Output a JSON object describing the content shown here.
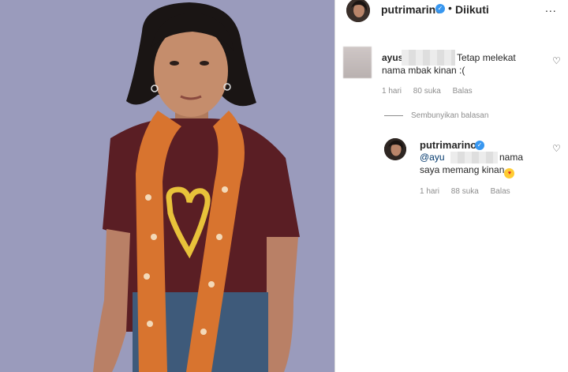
{
  "header": {
    "username": "putrimarino",
    "separator": "•",
    "follow_status": "Diikuti",
    "more_icon": "..."
  },
  "comments": [
    {
      "username": "ayus",
      "text_line1": "Tetap melekat",
      "text_line2": "nama mbak kinan :(",
      "time": "1 hari",
      "likes": "80 suka",
      "reply_label": "Balas"
    }
  ],
  "hide_replies": "Sembunyikan balasan",
  "reply": {
    "username": "putrimarino",
    "mention": "@ayu",
    "text_line1": "nama",
    "text_line2": "saya memang kinan",
    "time": "1 hari",
    "likes": "88 suka",
    "reply_label": "Balas"
  },
  "icons": {
    "verified": "verified-badge-icon",
    "heart": "heart-outline-icon",
    "more": "more-horizontal-icon"
  },
  "colors": {
    "verified_blue": "#3897f0",
    "mention": "#00376b",
    "meta_gray": "#8e8e8e",
    "photo_background": "#9a9bbc"
  }
}
